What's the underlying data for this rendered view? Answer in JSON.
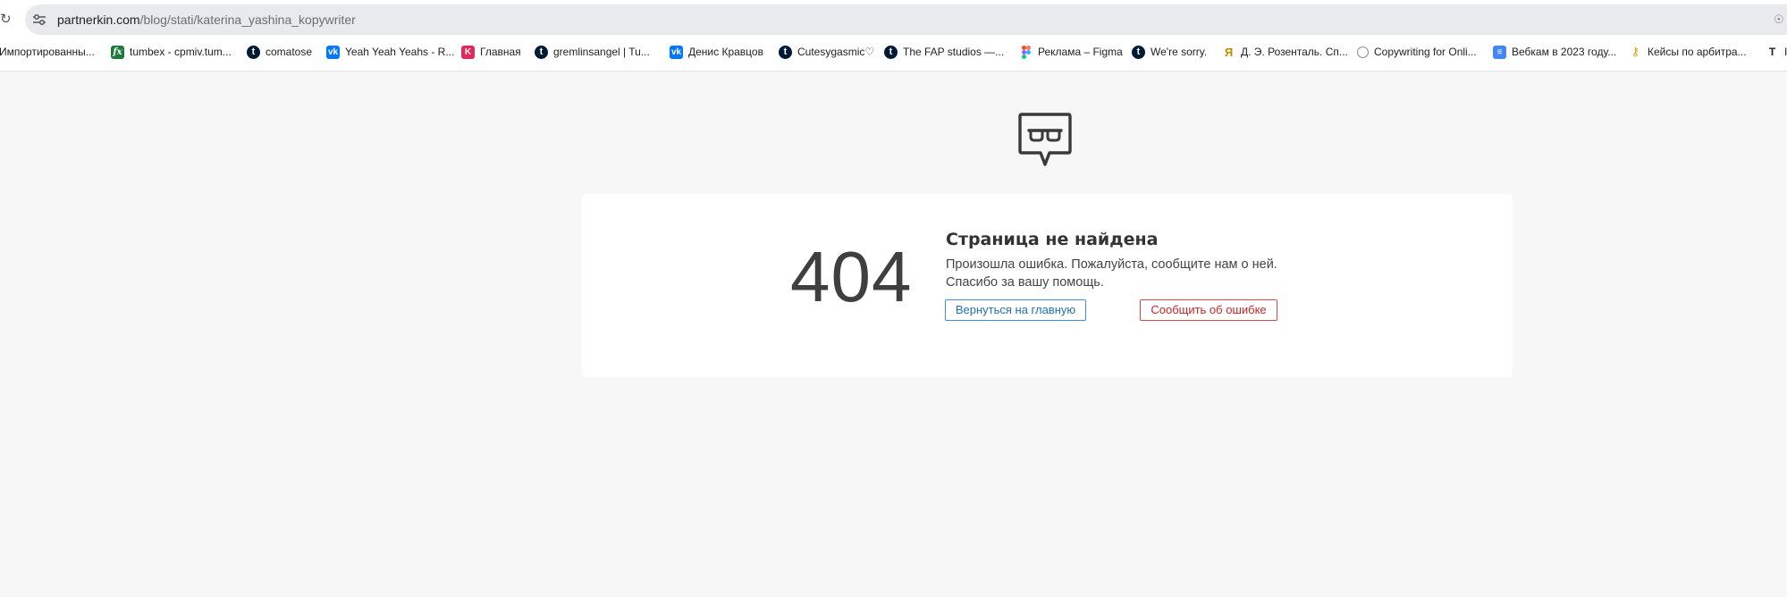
{
  "browser": {
    "url_host": "partnerkin.com",
    "url_path": "/blog/stati/katerina_yashina_kopywriter",
    "bookmarks": [
      {
        "label": "Импортированны...",
        "icon": "none"
      },
      {
        "label": "tumbex - cpmiv.tum...",
        "icon": "fx"
      },
      {
        "label": "comatose",
        "icon": "t"
      },
      {
        "label": "Yeah Yeah Yeahs - R...",
        "icon": "vk"
      },
      {
        "label": "Главная",
        "icon": "k"
      },
      {
        "label": "gremlinsangel | Tu...",
        "icon": "t"
      },
      {
        "label": "Денис Кравцов",
        "icon": "vk"
      },
      {
        "label": "Cutesygasmic♡",
        "icon": "t"
      },
      {
        "label": "The FAP studios —...",
        "icon": "t"
      },
      {
        "label": "Реклама – Figma",
        "icon": "fig"
      },
      {
        "label": "We're sorry.",
        "icon": "t"
      },
      {
        "label": "Д. Э. Розенталь. Сп...",
        "icon": "ya"
      },
      {
        "label": "Copywriting for Onli...",
        "icon": "cw"
      },
      {
        "label": "Вебкам в 2023 году...",
        "icon": "doc"
      },
      {
        "label": "Кейсы по арбитра...",
        "icon": "key"
      },
      {
        "label": "I",
        "icon": "plain"
      }
    ]
  },
  "error_page": {
    "code": "404",
    "title": "Страница не найдена",
    "description": "Произошла ошибка. Пожалуйста, сообщите нам о ней. Спасибо за вашу помощь.",
    "home_button": "Вернуться на главную",
    "report_button": "Сообщить об ошибке"
  },
  "colors": {
    "background": "#f7f7f7",
    "card": "#ffffff",
    "home_button": "#1f70b8",
    "report_button": "#c92525"
  }
}
